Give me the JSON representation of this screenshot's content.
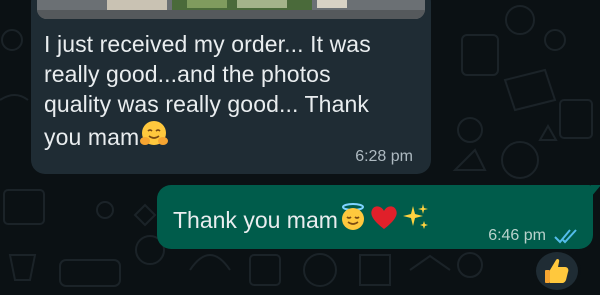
{
  "messages": {
    "incoming": {
      "lines": [
        "I just received my order... It was",
        "really good...and the photos",
        "quality was really good... Thank",
        "you mam"
      ],
      "emoji": "hugging-face-emoji",
      "time": "6:28 pm"
    },
    "outgoing": {
      "text": "Thank you mam",
      "emojis": [
        "smiling-face-with-halo-emoji",
        "red-heart-emoji",
        "sparkles-emoji"
      ],
      "time": "6:46 pm",
      "status": "read-double-check-icon"
    }
  },
  "reaction": {
    "emoji": "thumbs-up-emoji"
  },
  "colors": {
    "incoming_bubble": "#1f2c34",
    "outgoing_bubble": "#005c4b",
    "read_ticks": "#53bdeb",
    "background": "#0b1114"
  }
}
